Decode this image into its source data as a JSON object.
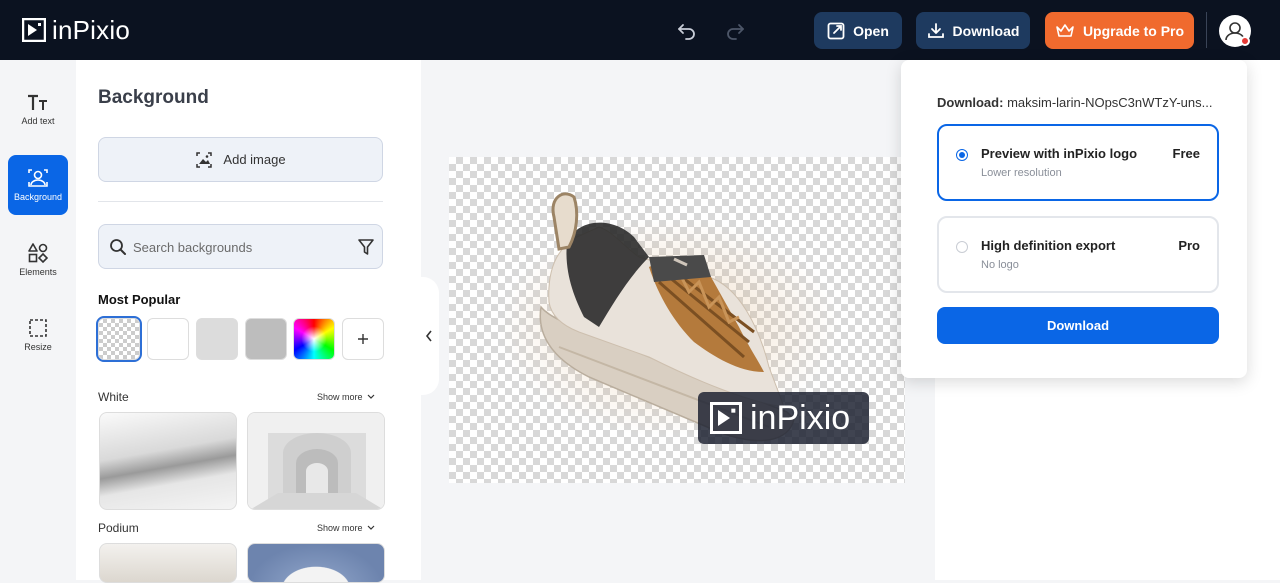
{
  "app": {
    "logo_text": "inPixio"
  },
  "topbar": {
    "open_label": "Open",
    "download_label": "Download",
    "upgrade_label": "Upgrade to Pro"
  },
  "rail": {
    "items": [
      {
        "label": "Add text",
        "icon": "text-icon"
      },
      {
        "label": "Background",
        "icon": "background-icon",
        "active": true
      },
      {
        "label": "Elements",
        "icon": "elements-icon"
      },
      {
        "label": "Resize",
        "icon": "resize-icon"
      }
    ]
  },
  "panel": {
    "title": "Background",
    "add_image_label": "Add image",
    "search_placeholder": "Search backgrounds",
    "most_popular_label": "Most Popular",
    "categories": [
      {
        "label": "White",
        "show_more": "Show more"
      },
      {
        "label": "Podium",
        "show_more": "Show more"
      }
    ]
  },
  "canvas": {
    "watermark_text": "inPixio"
  },
  "download_menu": {
    "heading_label": "Download:",
    "filename": "maksim-larin-NOpsC3nWTzY-uns...",
    "options": [
      {
        "title": "Preview with inPixio logo",
        "subtitle": "Lower resolution",
        "tag": "Free",
        "selected": true
      },
      {
        "title": "High definition export",
        "subtitle": "No logo",
        "tag": "Pro",
        "selected": false
      }
    ],
    "button_label": "Download"
  },
  "colors": {
    "topbar_bg": "#0b1220",
    "accent_blue": "#0a66e6",
    "upgrade_orange": "#f06a2e",
    "button_dark": "#1e3a5f"
  }
}
